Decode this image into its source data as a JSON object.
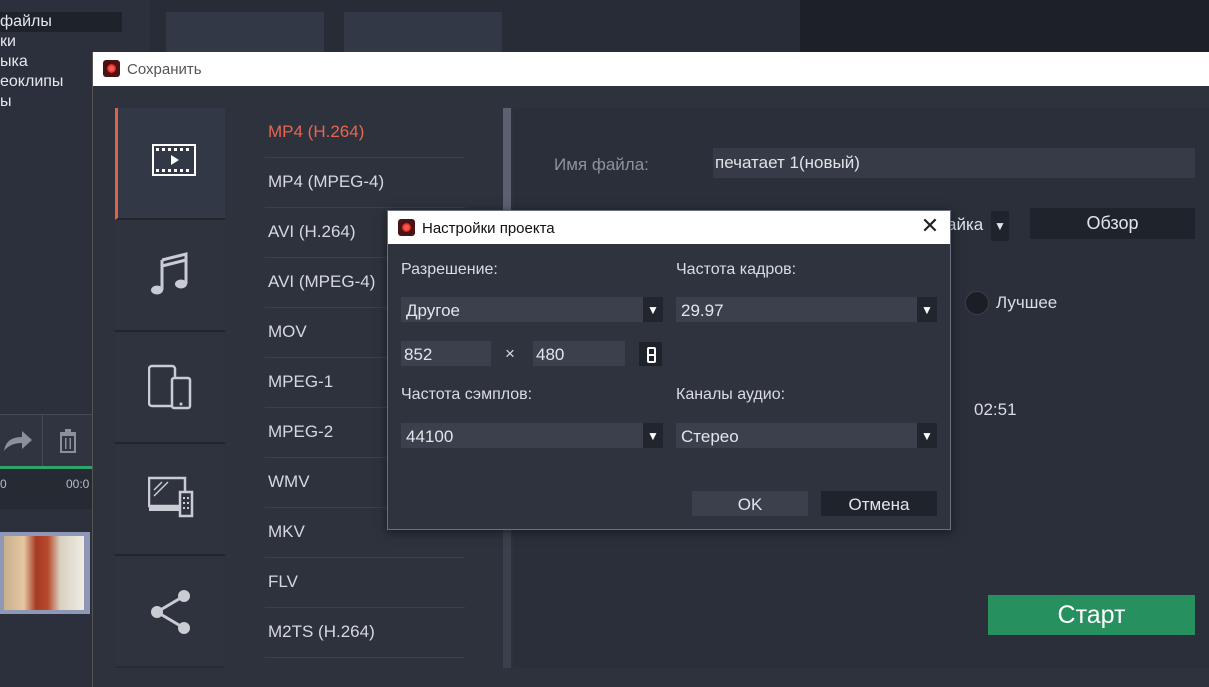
{
  "background_app": {
    "sidebar_items": [
      "файлы",
      "ки",
      "ыка",
      "еоклипы",
      "ы"
    ],
    "timeline_time": "0",
    "timeline_time_2": "00:0"
  },
  "save_window": {
    "title": "Сохранить",
    "categories": [
      "video-icon",
      "music-icon",
      "devices-icon",
      "tv-icon",
      "share-icon"
    ],
    "formats": [
      "MP4 (H.264)",
      "MP4 (MPEG-4)",
      "AVI (H.264)",
      "AVI (MPEG-4)",
      "MOV",
      "MPEG-1",
      "MPEG-2",
      "WMV",
      "MKV",
      "FLV",
      "M2TS (H.264)"
    ],
    "selected_format": "MP4 (H.264)",
    "filename_label": "Имя файла:",
    "filename_value": "печатает 1(новый)",
    "folder_value": "айка",
    "browse_label": "Обзор",
    "quality_label": "Лучшее",
    "duration": "02:51",
    "start_label": "Старт"
  },
  "dialog": {
    "title": "Настройки проекта",
    "resolution_label": "Разрешение:",
    "resolution_value": "Другое",
    "width_value": "852",
    "times_sign": "×",
    "height_value": "480",
    "framerate_label": "Частота кадров:",
    "framerate_value": "29.97",
    "samplerate_label": "Частота сэмплов:",
    "samplerate_value": "44100",
    "channels_label": "Каналы аудио:",
    "channels_value": "Стерео",
    "ok_label": "OK",
    "cancel_label": "Отмена",
    "close_glyph": "✕",
    "dropdown_arrow": "▼"
  },
  "colors": {
    "accent": "#e8654f",
    "start_green": "#27905f",
    "background": "#2d323d"
  }
}
